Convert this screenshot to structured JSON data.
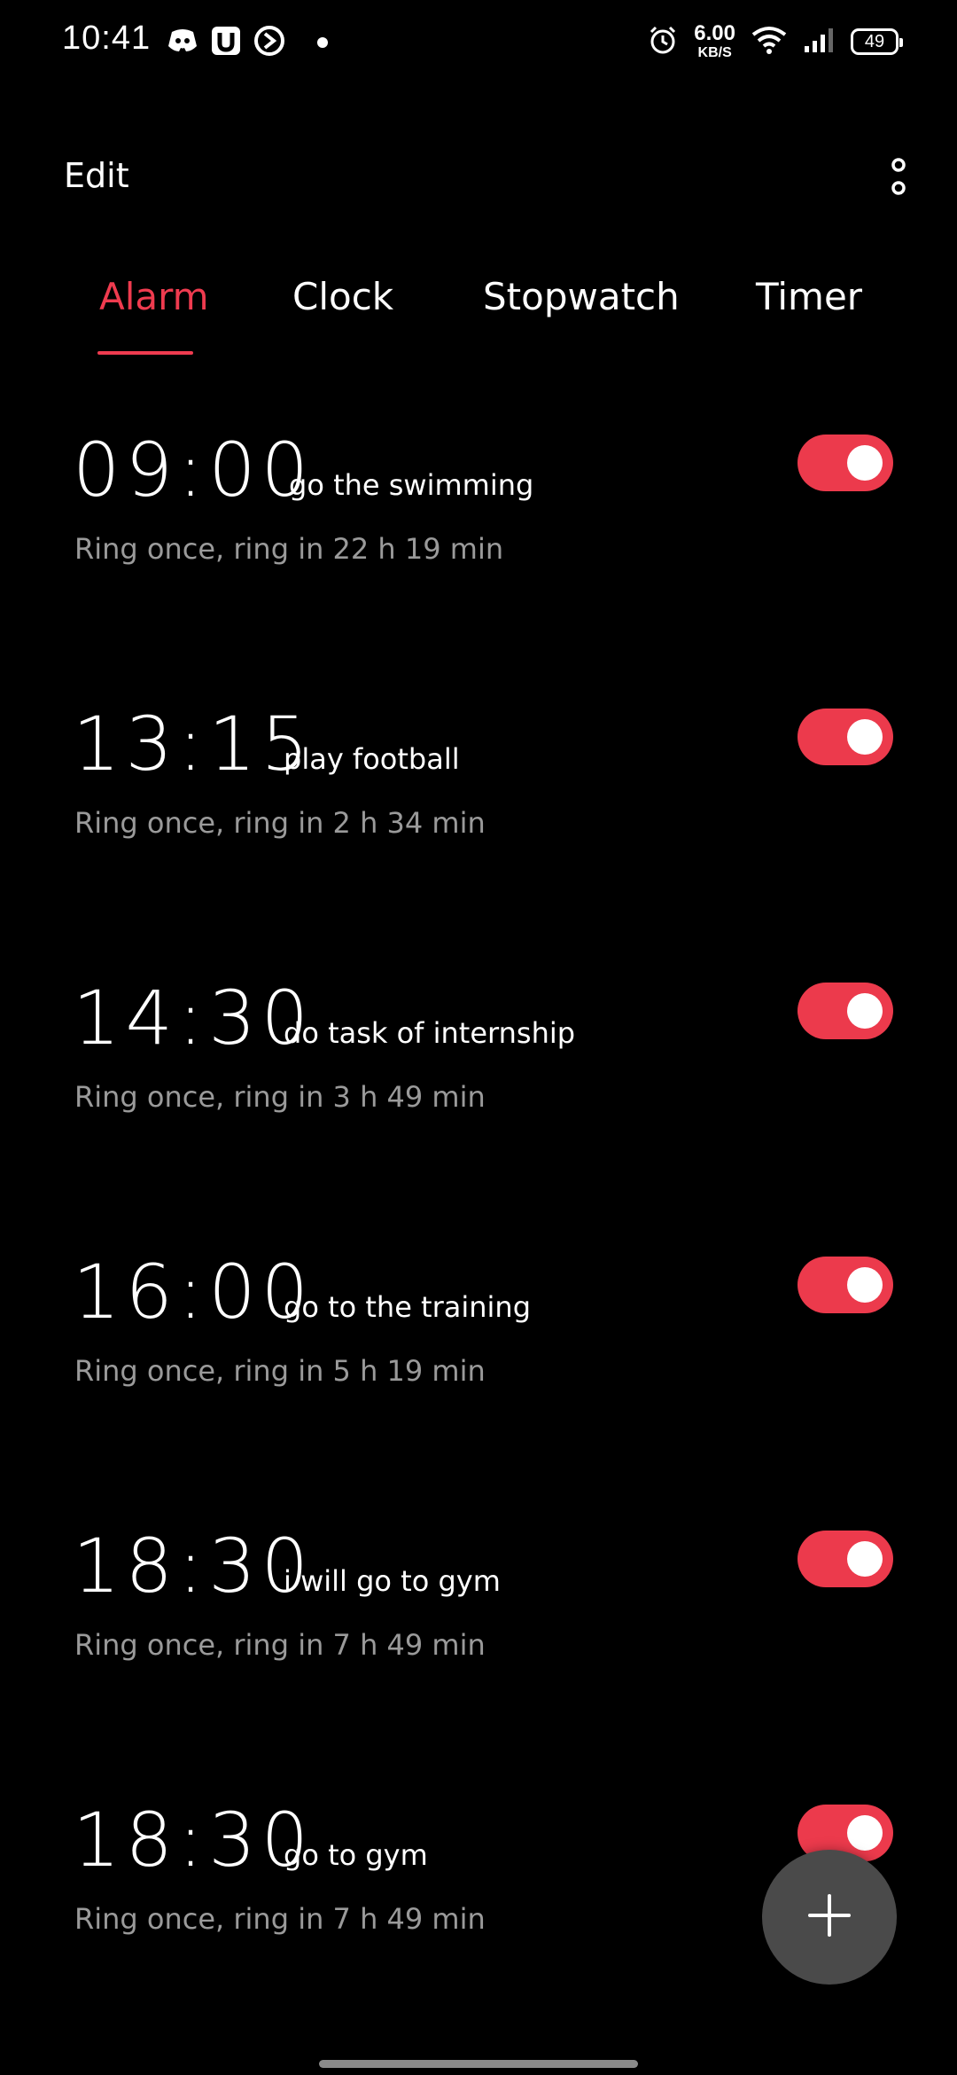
{
  "status_bar": {
    "time": "10:41",
    "net_speed_value": "6.00",
    "net_speed_unit": "KB/S",
    "battery": "49",
    "icons": [
      "discord-icon",
      "u-app-icon",
      "play-circle-icon",
      "alarm-icon",
      "wifi-icon",
      "signal-icon",
      "battery-icon"
    ]
  },
  "header": {
    "edit_label": "Edit"
  },
  "tabs": [
    {
      "label": "Alarm",
      "active": true
    },
    {
      "label": "Clock",
      "active": false
    },
    {
      "label": "Stopwatch",
      "active": false
    },
    {
      "label": "Timer",
      "active": false
    }
  ],
  "alarms": [
    {
      "time": "09:00",
      "label": "go the swimming",
      "subtitle": "Ring once, ring in 22 h 19 min",
      "enabled": true
    },
    {
      "time": "13:15",
      "label": "play football",
      "subtitle": "Ring once, ring in 2 h 34 min",
      "enabled": true
    },
    {
      "time": "14:30",
      "label": "do task of internship",
      "subtitle": "Ring once, ring in 3 h 49 min",
      "enabled": true
    },
    {
      "time": "16:00",
      "label": "go to the training",
      "subtitle": "Ring once, ring in 5 h 19 min",
      "enabled": true
    },
    {
      "time": "18:30",
      "label": "i will go to gym",
      "subtitle": "Ring once, ring in 7 h 49 min",
      "enabled": true
    },
    {
      "time": "18:30",
      "label": "go to gym",
      "subtitle": "Ring once, ring in 7 h 49 min",
      "enabled": true
    }
  ],
  "colors": {
    "accent": "#ef3b4f",
    "toggle_on": "#ec3a4c",
    "background": "#000000",
    "subtitle": "#9a9a9a",
    "fab": "#4a4a4a"
  }
}
